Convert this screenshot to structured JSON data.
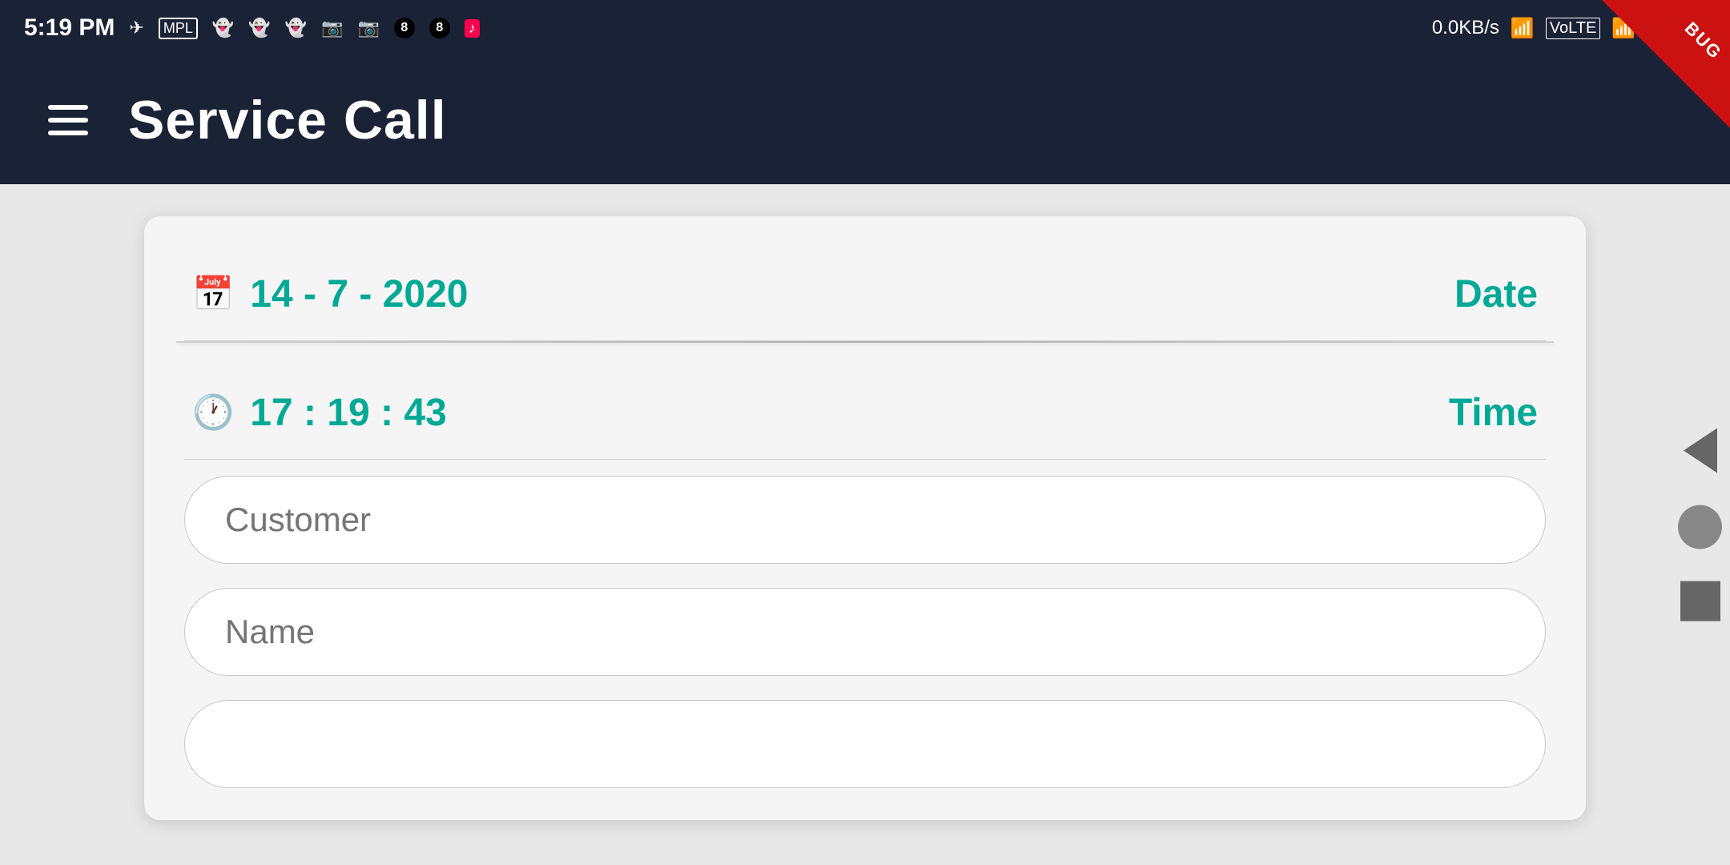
{
  "statusBar": {
    "time": "5:19 PM",
    "network": "0.0KB/s",
    "icons": [
      "telegram",
      "mpl",
      "snapchat1",
      "snapchat2",
      "snapchat3",
      "instagram1",
      "instagram2",
      "ball8",
      "ball8v2",
      "tiktok"
    ],
    "debugLabel": "BUG"
  },
  "header": {
    "menuIcon": "≡",
    "title": "Service Call"
  },
  "form": {
    "dateLabel": "Date",
    "dateValue": "14 - 7 - 2020",
    "timeLabel": "Time",
    "timeValue": "17 : 19 : 43",
    "customerPlaceholder": "Customer",
    "namePlaceholder": "Name",
    "thirdFieldPlaceholder": ""
  },
  "colors": {
    "headerBg": "#1a2236",
    "teal": "#00a896",
    "cardBg": "#f5f5f5",
    "inputBorder": "#c8c8c8",
    "debugRed": "#cc1111"
  }
}
